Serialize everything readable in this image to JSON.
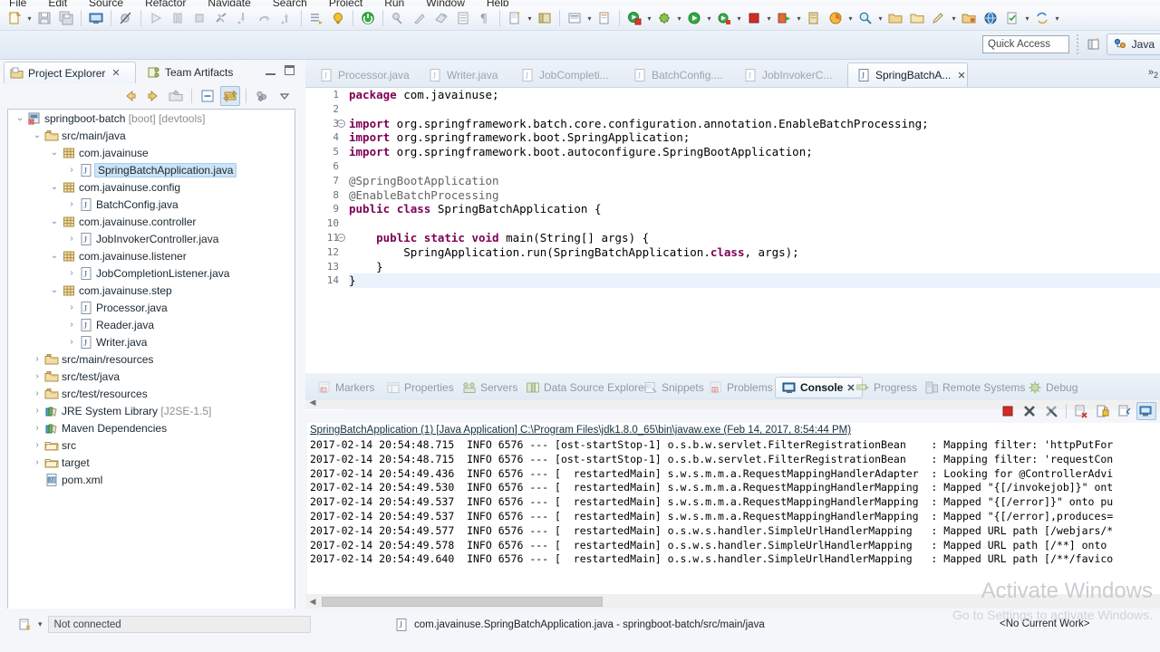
{
  "menu": {
    "items": [
      "File",
      "Edit",
      "Source",
      "Refactor",
      "Navigate",
      "Search",
      "Project",
      "Run",
      "Window",
      "Help"
    ]
  },
  "toolbar": {
    "quick_access_placeholder": "Quick Access",
    "perspective_label": "Java",
    "buttons": [
      "new-wizard",
      "save",
      "save-all",
      "console-view",
      "toggle-breakpoint-skip",
      "resume",
      "suspend",
      "terminate",
      "disconnect",
      "step-into",
      "step-over",
      "step-return",
      "open-task",
      "open-type",
      "run-last",
      "debug-last",
      "external-tools",
      "coverage",
      "toggle-block-selection",
      "show-whitespace",
      "new-java-project",
      "open-perspective",
      "new-java-class",
      "new-package",
      "search",
      "run",
      "debug",
      "stop",
      "profile",
      "git-commit",
      "git-push",
      "git-pull",
      "server",
      "sync",
      "validate",
      "annotate",
      "help"
    ]
  },
  "project_explorer": {
    "tabs": [
      {
        "label": "Project Explorer",
        "icon": "project-explorer-icon",
        "active": true,
        "closable": true
      },
      {
        "label": "Team Artifacts",
        "icon": "team-artifacts-icon",
        "active": false,
        "closable": false
      }
    ],
    "view_buttons": [
      "minimize-view-button",
      "maximize-view-button"
    ],
    "toolbar_buttons": [
      "back-icon",
      "forward-icon",
      "up-icon",
      "collapse-all-icon",
      "link-with-editor-icon",
      "view-menu-icon",
      "view-dropdown-icon"
    ],
    "tree": [
      {
        "indent": 0,
        "arrow": "down",
        "icon": "spring-project-icon",
        "label": "springboot-batch",
        "suffix": " [boot] [devtools]",
        "selected": false
      },
      {
        "indent": 1,
        "arrow": "down",
        "icon": "source-folder-icon",
        "label": "src/main/java",
        "suffix": "",
        "selected": false
      },
      {
        "indent": 2,
        "arrow": "down",
        "icon": "package-icon",
        "label": "com.javainuse",
        "suffix": "",
        "selected": false
      },
      {
        "indent": 3,
        "arrow": "right",
        "icon": "java-file-icon",
        "label": "SpringBatchApplication.java",
        "suffix": "",
        "selected": true
      },
      {
        "indent": 2,
        "arrow": "down",
        "icon": "package-icon",
        "label": "com.javainuse.config",
        "suffix": "",
        "selected": false
      },
      {
        "indent": 3,
        "arrow": "right",
        "icon": "java-file-icon",
        "label": "BatchConfig.java",
        "suffix": "",
        "selected": false
      },
      {
        "indent": 2,
        "arrow": "down",
        "icon": "package-icon",
        "label": "com.javainuse.controller",
        "suffix": "",
        "selected": false
      },
      {
        "indent": 3,
        "arrow": "right",
        "icon": "java-file-icon",
        "label": "JobInvokerController.java",
        "suffix": "",
        "selected": false
      },
      {
        "indent": 2,
        "arrow": "down",
        "icon": "package-icon",
        "label": "com.javainuse.listener",
        "suffix": "",
        "selected": false
      },
      {
        "indent": 3,
        "arrow": "right",
        "icon": "java-file-icon",
        "label": "JobCompletionListener.java",
        "suffix": "",
        "selected": false
      },
      {
        "indent": 2,
        "arrow": "down",
        "icon": "package-icon",
        "label": "com.javainuse.step",
        "suffix": "",
        "selected": false
      },
      {
        "indent": 3,
        "arrow": "right",
        "icon": "java-file-icon",
        "label": "Processor.java",
        "suffix": "",
        "selected": false
      },
      {
        "indent": 3,
        "arrow": "right",
        "icon": "java-file-icon",
        "label": "Reader.java",
        "suffix": "",
        "selected": false
      },
      {
        "indent": 3,
        "arrow": "right",
        "icon": "java-file-icon",
        "label": "Writer.java",
        "suffix": "",
        "selected": false
      },
      {
        "indent": 1,
        "arrow": "right",
        "icon": "source-folder-icon",
        "label": "src/main/resources",
        "suffix": "",
        "selected": false
      },
      {
        "indent": 1,
        "arrow": "right",
        "icon": "source-folder-icon",
        "label": "src/test/java",
        "suffix": "",
        "selected": false
      },
      {
        "indent": 1,
        "arrow": "right",
        "icon": "source-folder-icon",
        "label": "src/test/resources",
        "suffix": "",
        "selected": false
      },
      {
        "indent": 1,
        "arrow": "right",
        "icon": "library-icon",
        "label": "JRE System Library",
        "suffix": " [J2SE-1.5]",
        "selected": false
      },
      {
        "indent": 1,
        "arrow": "right",
        "icon": "library-icon",
        "label": "Maven Dependencies",
        "suffix": "",
        "selected": false
      },
      {
        "indent": 1,
        "arrow": "right",
        "icon": "folder-icon",
        "label": "src",
        "suffix": "",
        "selected": false
      },
      {
        "indent": 1,
        "arrow": "right",
        "icon": "folder-icon",
        "label": "target",
        "suffix": "",
        "selected": false
      },
      {
        "indent": 1,
        "arrow": "none",
        "icon": "maven-pom-icon",
        "label": "pom.xml",
        "suffix": "",
        "selected": false
      }
    ]
  },
  "editor": {
    "tabs": [
      {
        "label": "Processor.java",
        "active": false
      },
      {
        "label": "Writer.java",
        "active": false
      },
      {
        "label": "JobCompleti...",
        "active": false
      },
      {
        "label": "BatchConfig....",
        "active": false
      },
      {
        "label": "JobInvokerC...",
        "active": false
      },
      {
        "label": "SpringBatchA...",
        "active": true
      }
    ],
    "overflow_label": "»",
    "overflow_count": "2",
    "lines": [
      {
        "n": 1,
        "fold": false,
        "text": "package com.javainuse;"
      },
      {
        "n": 2,
        "fold": false,
        "text": ""
      },
      {
        "n": 3,
        "fold": true,
        "text": "import org.springframework.batch.core.configuration.annotation.EnableBatchProcessing;"
      },
      {
        "n": 4,
        "fold": false,
        "text": "import org.springframework.boot.SpringApplication;"
      },
      {
        "n": 5,
        "fold": false,
        "text": "import org.springframework.boot.autoconfigure.SpringBootApplication;"
      },
      {
        "n": 6,
        "fold": false,
        "text": ""
      },
      {
        "n": 7,
        "fold": false,
        "text": "@SpringBootApplication"
      },
      {
        "n": 8,
        "fold": false,
        "text": "@EnableBatchProcessing"
      },
      {
        "n": 9,
        "fold": false,
        "text": "public class SpringBatchApplication {"
      },
      {
        "n": 10,
        "fold": false,
        "text": ""
      },
      {
        "n": 11,
        "fold": true,
        "text": "    public static void main(String[] args) {"
      },
      {
        "n": 12,
        "fold": false,
        "text": "        SpringApplication.run(SpringBatchApplication.class, args);"
      },
      {
        "n": 13,
        "fold": false,
        "text": "    }"
      },
      {
        "n": 14,
        "fold": false,
        "text": "}"
      }
    ]
  },
  "bottom_panel": {
    "tabs": [
      {
        "label": "Markers",
        "icon": "markers-icon",
        "active": false
      },
      {
        "label": "Properties",
        "icon": "properties-icon",
        "active": false
      },
      {
        "label": "Servers",
        "icon": "servers-icon",
        "active": false
      },
      {
        "label": "Data Source Explorer",
        "icon": "data-source-explorer-icon",
        "active": false
      },
      {
        "label": "Snippets",
        "icon": "snippets-icon",
        "active": false
      },
      {
        "label": "Problems",
        "icon": "problems-icon",
        "active": false
      },
      {
        "label": "Console",
        "icon": "console-icon",
        "active": true,
        "closable": true
      },
      {
        "label": "Progress",
        "icon": "progress-icon",
        "active": false
      },
      {
        "label": "Remote Systems",
        "icon": "remote-systems-icon",
        "active": false
      },
      {
        "label": "Debug",
        "icon": "debug-icon",
        "active": false
      }
    ],
    "toolbar_buttons": [
      "terminate-icon",
      "remove-launch-icon",
      "remove-all-launches-icon",
      "clear-console-icon",
      "scroll-lock-icon",
      "pin-console-icon",
      "display-selected-console-icon"
    ],
    "console": {
      "header": "SpringBatchApplication (1) [Java Application] C:\\Program Files\\jdk1.8.0_65\\bin\\javaw.exe (Feb 14, 2017, 8:54:44 PM)",
      "lines": [
        "2017-02-14 20:54:48.715  INFO 6576 --- [ost-startStop-1] o.s.b.w.servlet.FilterRegistrationBean    : Mapping filter: 'httpPutFor",
        "2017-02-14 20:54:48.715  INFO 6576 --- [ost-startStop-1] o.s.b.w.servlet.FilterRegistrationBean    : Mapping filter: 'requestCon",
        "2017-02-14 20:54:49.436  INFO 6576 --- [  restartedMain] s.w.s.m.m.a.RequestMappingHandlerAdapter  : Looking for @ControllerAdvi",
        "2017-02-14 20:54:49.530  INFO 6576 --- [  restartedMain] s.w.s.m.m.a.RequestMappingHandlerMapping  : Mapped \"{[/invokejob]}\" ont",
        "2017-02-14 20:54:49.537  INFO 6576 --- [  restartedMain] s.w.s.m.m.a.RequestMappingHandlerMapping  : Mapped \"{[/error]}\" onto pu",
        "2017-02-14 20:54:49.537  INFO 6576 --- [  restartedMain] s.w.s.m.m.a.RequestMappingHandlerMapping  : Mapped \"{[/error],produces=",
        "2017-02-14 20:54:49.577  INFO 6576 --- [  restartedMain] o.s.w.s.handler.SimpleUrlHandlerMapping   : Mapped URL path [/webjars/*",
        "2017-02-14 20:54:49.578  INFO 6576 --- [  restartedMain] o.s.w.s.handler.SimpleUrlHandlerMapping   : Mapped URL path [/**] onto ",
        "2017-02-14 20:54:49.640  INFO 6576 --- [  restartedMain] o.s.w.s.handler.SimpleUrlHandlerMapping   : Mapped URL path [/**/favico"
      ]
    }
  },
  "status_bar": {
    "connection_status": "Not connected",
    "file_path": "com.javainuse.SpringBatchApplication.java - springboot-batch/src/main/java",
    "current_work": "<No Current Work>"
  },
  "watermark": {
    "line1": "Activate Windows",
    "line2": "Go to Settings to activate Windows."
  },
  "colors": {
    "keyword": "#7f0055",
    "annotation": "#646464",
    "selection": "#cde3f7",
    "accent_blue": "#3c7fb1",
    "console_text": "#000000"
  }
}
